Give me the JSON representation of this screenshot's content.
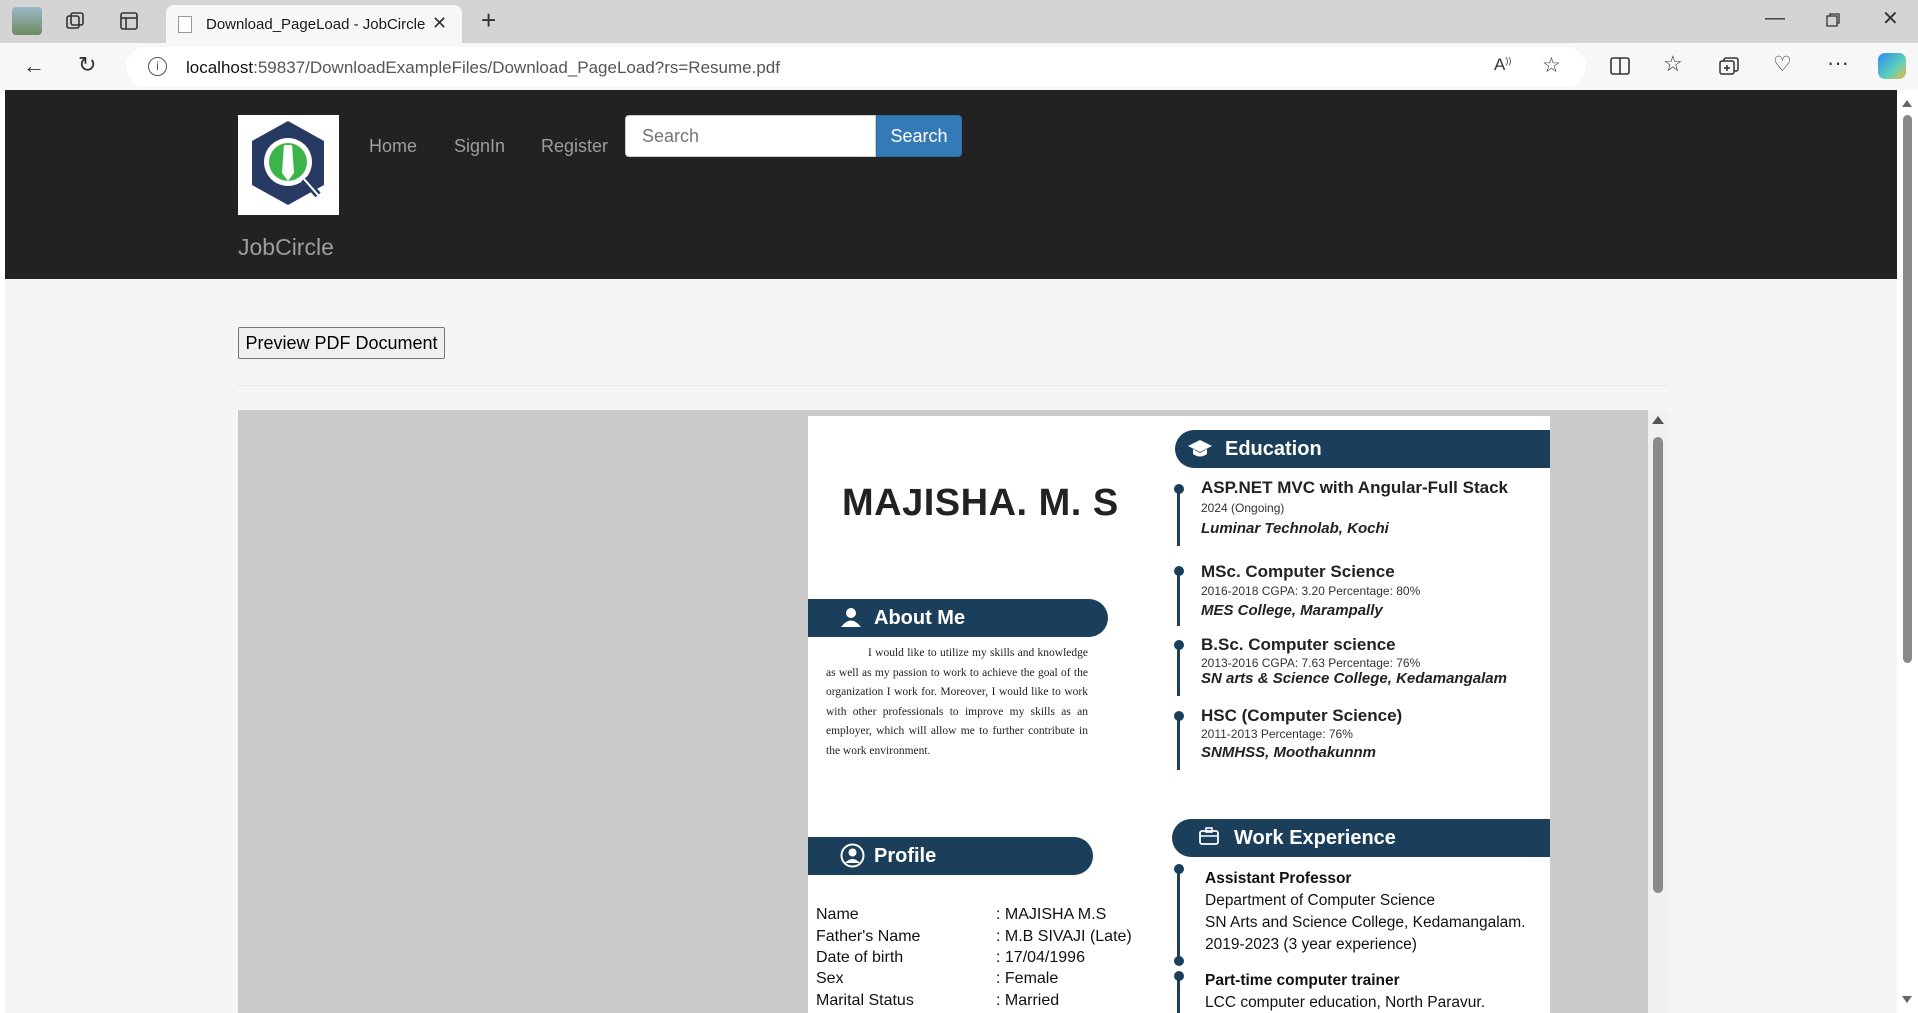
{
  "browser": {
    "tab_title": "Download_PageLoad - JobCircle",
    "url_host": "localhost",
    "url_rest": ":59837/DownloadExampleFiles/Download_PageLoad?rs=Resume.pdf"
  },
  "site": {
    "nav": {
      "home": "Home",
      "signin": "SignIn",
      "register": "Register"
    },
    "search_placeholder": "Search",
    "search_button": "Search",
    "brand": "JobCircle",
    "preview_button": "Preview PDF Document"
  },
  "resume": {
    "name": "MAJISHA. M. S",
    "about_title": "About Me",
    "about_text": "I would like to utilize my skills and knowledge as well as my passion to work to achieve the goal of the organization I work for. Moreover, I would like to work with other professionals to improve my skills as an employer, which will allow me to further contribute in the work environment.",
    "profile_title": "Profile",
    "profile": [
      {
        "label": "Name",
        "value": ": MAJISHA M.S"
      },
      {
        "label": "Father's Name",
        "value": ": M.B SIVAJI (Late)"
      },
      {
        "label": "Date of birth",
        "value": ": 17/04/1996"
      },
      {
        "label": "Sex",
        "value": ": Female"
      },
      {
        "label": "Marital Status",
        "value": ": Married"
      }
    ],
    "education_title": "Education",
    "education": [
      {
        "degree": "ASP.NET MVC with Angular-Full Stack",
        "detail": "2024  (Ongoing)",
        "institute": "Luminar Technolab, Kochi"
      },
      {
        "degree": "MSc. Computer Science",
        "detail": "2016-2018    CGPA: 3.20  Percentage: 80%",
        "institute": "MES College, Marampally"
      },
      {
        "degree": "B.Sc. Computer science",
        "detail": "2013-2016    CGPA: 7.63  Percentage: 76%",
        "institute": "SN arts & Science College, Kedamangalam"
      },
      {
        "degree": "HSC (Computer Science)",
        "detail": "2011-2013  Percentage: 76%",
        "institute": "SNMHSS, Moothakunnm"
      }
    ],
    "work_title": "Work Experience",
    "work": [
      {
        "role": "Assistant Professor",
        "dept": "Department of Computer Science",
        "place": "SN Arts and Science College, Kedamangalam.",
        "period": "2019-2023 (3 year experience)"
      },
      {
        "role": "Part-time computer trainer",
        "place": "LCC computer education, North Paravur."
      }
    ]
  }
}
